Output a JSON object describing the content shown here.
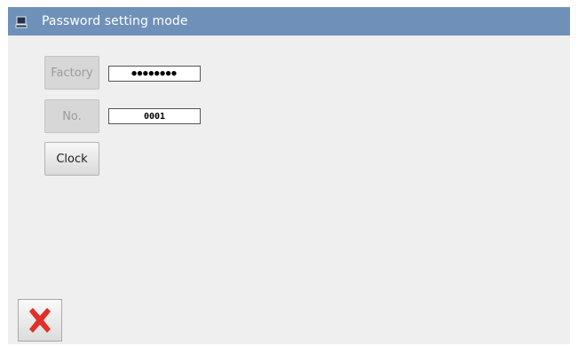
{
  "window": {
    "title": "Password setting mode",
    "title_icon": "computer-icon"
  },
  "rows": [
    {
      "button_label": "Factory",
      "button_enabled": false,
      "field_value": "●●●●●●●●"
    },
    {
      "button_label": "No.",
      "button_enabled": false,
      "field_value": "0001"
    },
    {
      "button_label": "Clock",
      "button_enabled": true
    }
  ],
  "footer": {
    "close_icon": "close-icon",
    "close_color": "#e0302a"
  },
  "colors": {
    "titlebar": "#6f91b9",
    "background": "#efefef"
  }
}
